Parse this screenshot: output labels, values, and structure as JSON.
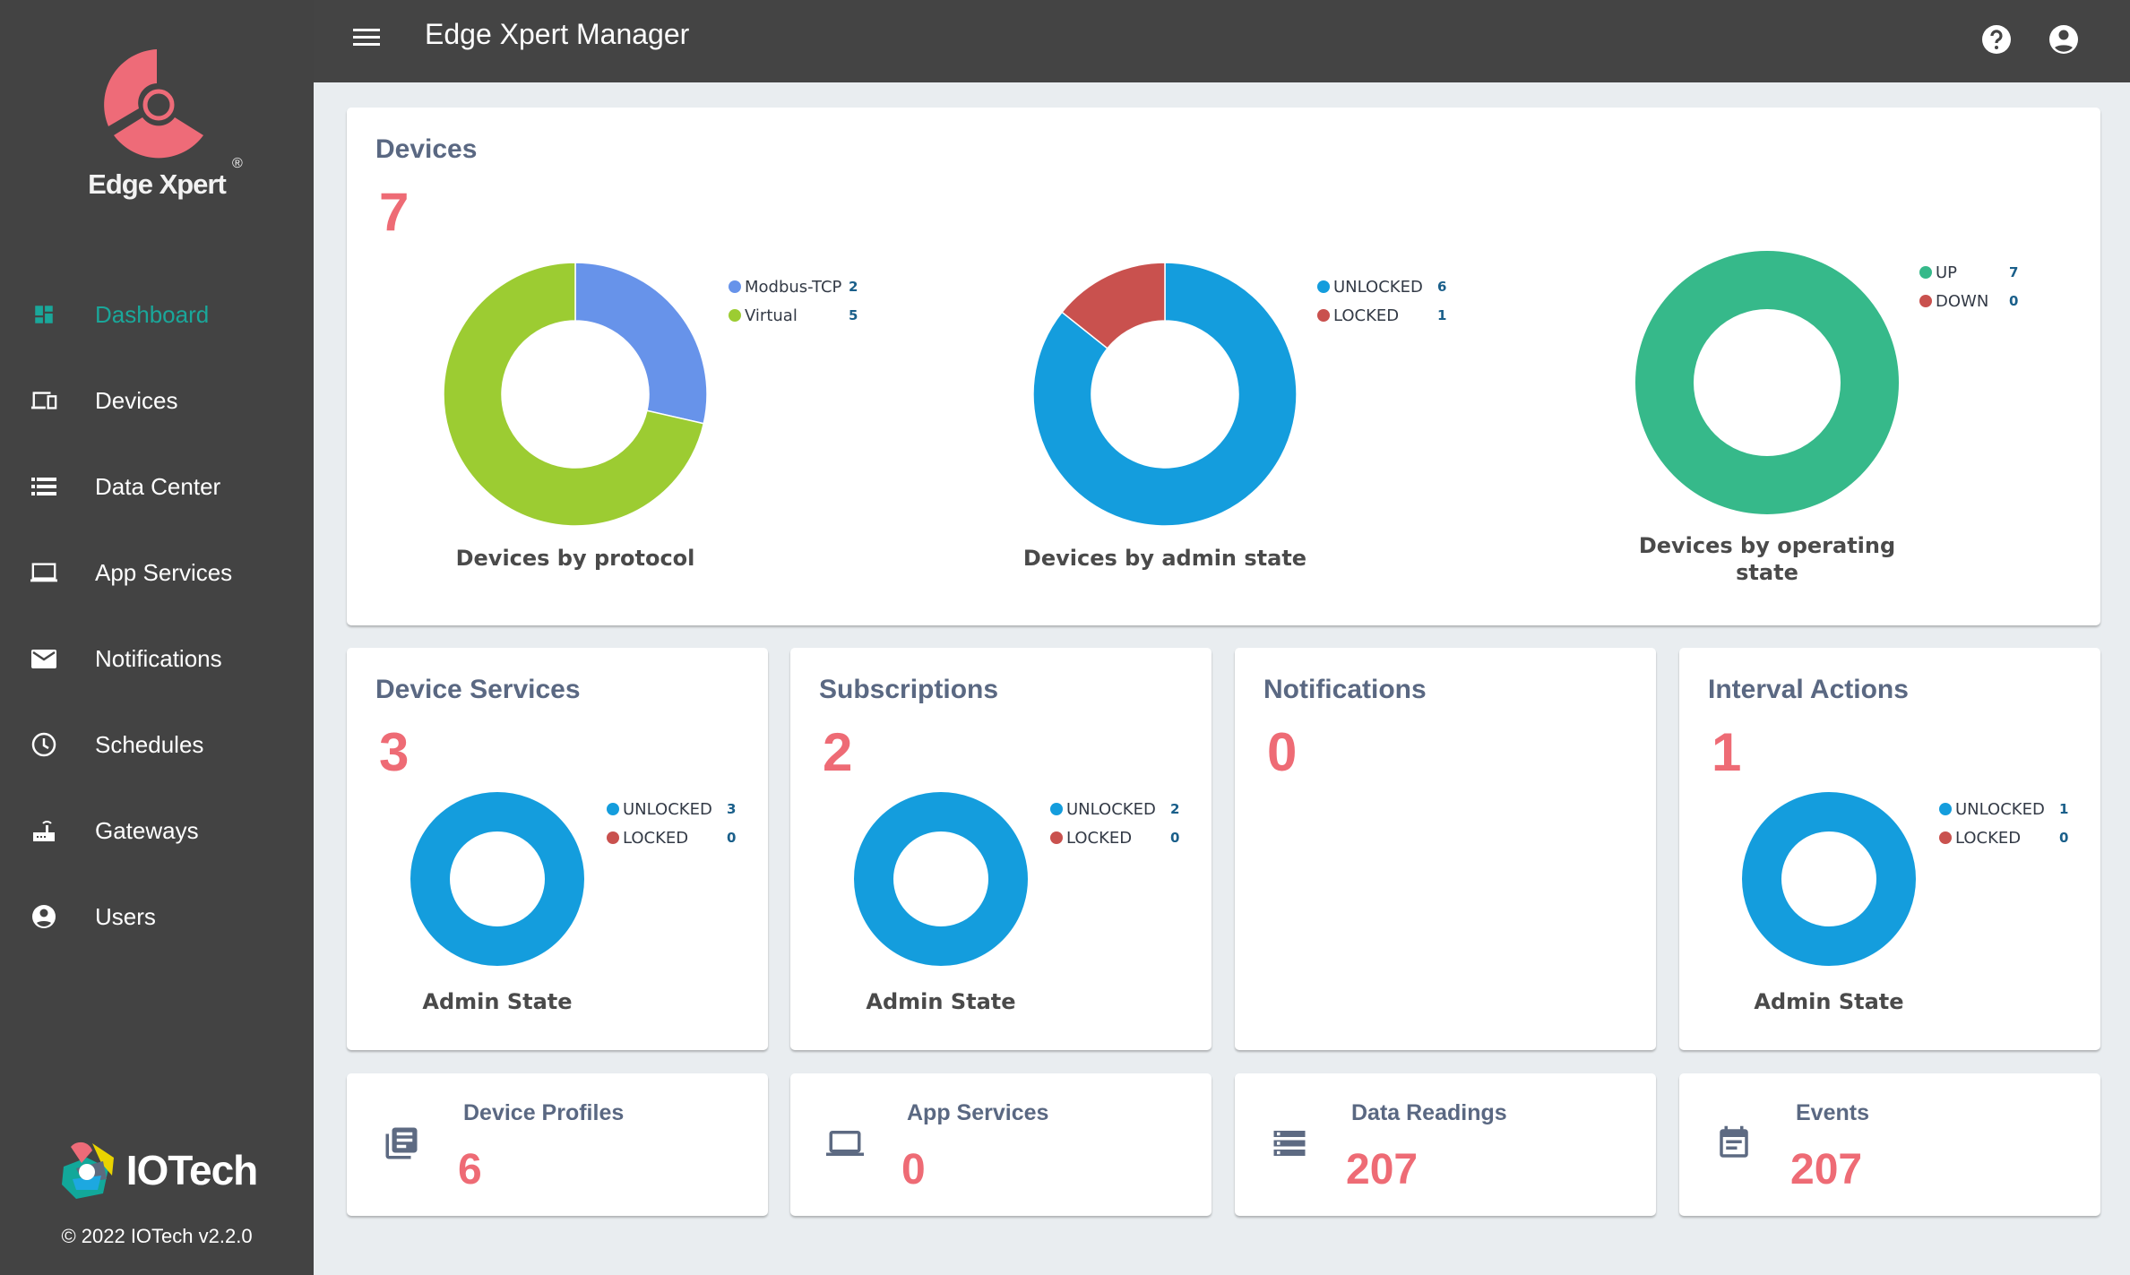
{
  "app": {
    "brand": "Edge Xpert",
    "registered_mark": "®",
    "title": "Edge Xpert Manager",
    "vendor": "IOTech",
    "copyright": "© 2022 IOTech v2.2.0"
  },
  "colors": {
    "accent": "#1aa79a",
    "count": "#ee6b75",
    "title": "#5a6882",
    "sidebar_bg": "#434343",
    "topbar_bg": "#444444",
    "unlocked": "#149ddd",
    "locked": "#c9514e",
    "up": "#36b98a",
    "down": "#c9514e",
    "modbus": "#6793ea",
    "virtual": "#9ccc32"
  },
  "sidebar": {
    "items": [
      {
        "label": "Dashboard",
        "icon": "dashboard-icon",
        "active": true
      },
      {
        "label": "Devices",
        "icon": "devices-icon",
        "active": false
      },
      {
        "label": "Data Center",
        "icon": "list-icon",
        "active": false
      },
      {
        "label": "App Services",
        "icon": "laptop-icon",
        "active": false
      },
      {
        "label": "Notifications",
        "icon": "mail-icon",
        "active": false
      },
      {
        "label": "Schedules",
        "icon": "clock-icon",
        "active": false
      },
      {
        "label": "Gateways",
        "icon": "router-icon",
        "active": false
      },
      {
        "label": "Users",
        "icon": "account-circle-icon",
        "active": false
      }
    ]
  },
  "topbar": {
    "menu_icon": "menu-icon",
    "help_icon": "help-icon",
    "account_icon": "account-circle-icon"
  },
  "devices": {
    "title": "Devices",
    "count": "7"
  },
  "device_services": {
    "title": "Device Services",
    "count": "3",
    "caption": "Admin State"
  },
  "subscriptions": {
    "title": "Subscriptions",
    "count": "2",
    "caption": "Admin State"
  },
  "notifications": {
    "title": "Notifications",
    "count": "0"
  },
  "interval_actions": {
    "title": "Interval Actions",
    "count": "1",
    "caption": "Admin State"
  },
  "stats": [
    {
      "title": "Device Profiles",
      "count": "6",
      "icon": "library-books-icon"
    },
    {
      "title": "App Services",
      "count": "0",
      "icon": "laptop-icon"
    },
    {
      "title": "Data Readings",
      "count": "207",
      "icon": "storage-icon"
    },
    {
      "title": "Events",
      "count": "207",
      "icon": "event-note-icon"
    }
  ],
  "chart_data": [
    {
      "type": "pie",
      "title": "Devices by protocol",
      "categories": [
        "Modbus-TCP",
        "Virtual"
      ],
      "values": [
        2,
        5
      ],
      "colors": [
        "#6793ea",
        "#9ccc32"
      ],
      "legend": "top-right"
    },
    {
      "type": "pie",
      "title": "Devices by admin state",
      "categories": [
        "UNLOCKED",
        "LOCKED"
      ],
      "values": [
        6,
        1
      ],
      "colors": [
        "#149ddd",
        "#c9514e"
      ],
      "legend": "top-right"
    },
    {
      "type": "pie",
      "title": "Devices by operating state",
      "categories": [
        "UP",
        "DOWN"
      ],
      "values": [
        7,
        0
      ],
      "colors": [
        "#36b98a",
        "#c9514e"
      ],
      "legend": "top-right"
    },
    {
      "type": "pie",
      "title": "Admin State",
      "card": "Device Services",
      "categories": [
        "UNLOCKED",
        "LOCKED"
      ],
      "values": [
        3,
        0
      ],
      "colors": [
        "#149ddd",
        "#c9514e"
      ],
      "legend": "top-right"
    },
    {
      "type": "pie",
      "title": "Admin State",
      "card": "Subscriptions",
      "categories": [
        "UNLOCKED",
        "LOCKED"
      ],
      "values": [
        2,
        0
      ],
      "colors": [
        "#149ddd",
        "#c9514e"
      ],
      "legend": "top-right"
    },
    {
      "type": "pie",
      "title": "Admin State",
      "card": "Interval Actions",
      "categories": [
        "UNLOCKED",
        "LOCKED"
      ],
      "values": [
        1,
        0
      ],
      "colors": [
        "#149ddd",
        "#c9514e"
      ],
      "legend": "top-right"
    }
  ]
}
